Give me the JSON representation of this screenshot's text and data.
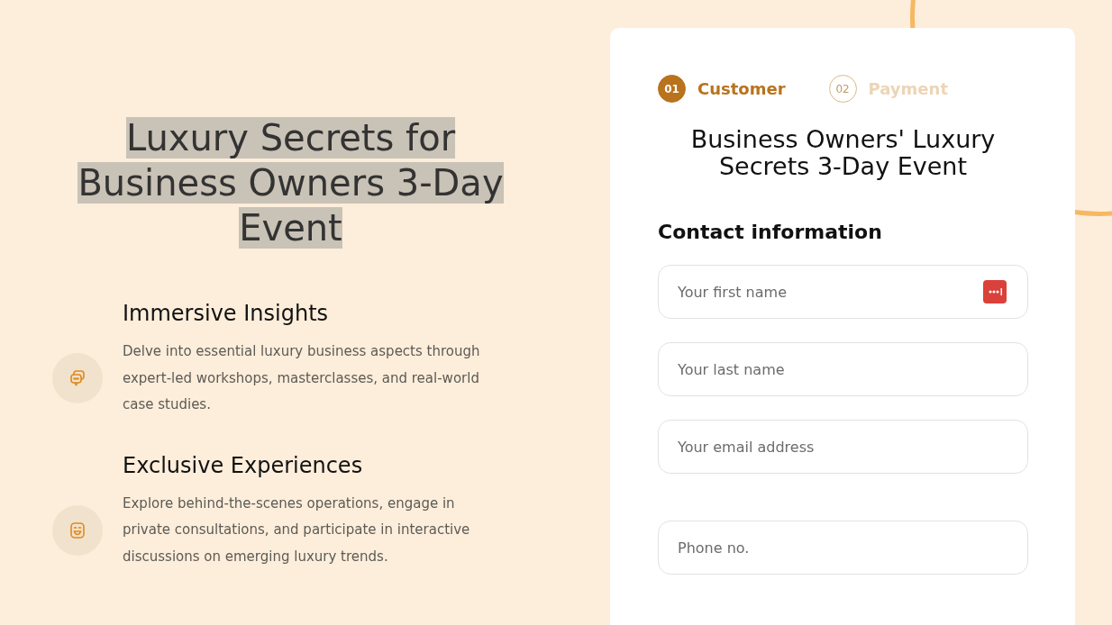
{
  "hero": {
    "title": "Luxury Secrets for Business Owners 3-Day Event",
    "highlighted": true
  },
  "features": [
    {
      "kind": "chat",
      "title": "Immersive Insights",
      "text": "Delve into essential luxury business aspects through expert-led workshops, masterclasses, and real-world case studies."
    },
    {
      "kind": "smile",
      "title": "Exclusive Experiences",
      "text": "Explore behind-the-scenes operations, engage in private consultations, and participate in interactive discussions on emerging luxury trends."
    }
  ],
  "form": {
    "steps": [
      {
        "number": "01",
        "label": "Customer",
        "selected": true
      },
      {
        "number": "02",
        "label": "Payment",
        "selected": false
      }
    ],
    "title": "Business Owners' Luxury Secrets 3-Day Event",
    "section": "Contact information",
    "fields": [
      {
        "placeholder": "Your first name",
        "autofill_button": true
      },
      {
        "placeholder": "Your last name",
        "autofill_button": false
      },
      {
        "placeholder": "Your email address",
        "autofill_button": false
      },
      {
        "placeholder": "Phone no.",
        "autofill_button": false
      }
    ]
  }
}
